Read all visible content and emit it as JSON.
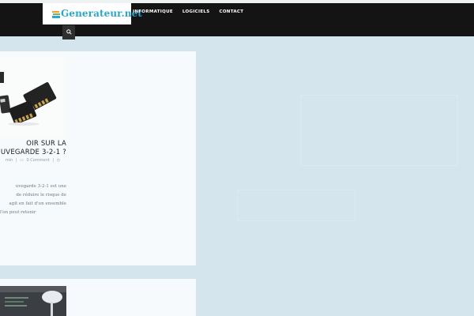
{
  "header": {
    "logo_text": "Generateur.net",
    "nav": [
      "INFORMATIQUE",
      "LOGICIELS",
      "CONTACT"
    ]
  },
  "search": {
    "icon": "search-icon"
  },
  "posts": [
    {
      "title_line1": "OIR SUR LA",
      "title_line2": "UVEGARDE 3-2-1 ?",
      "meta_author": "min",
      "meta_comments": "0 Comment",
      "meta_sep": "|",
      "excerpt": [
        "uvegarde 3-2-1 est une",
        "de réduire le risque de",
        "agit en fait d'un ensemble",
        "l'on peut retenir"
      ]
    }
  ],
  "colors": {
    "nav_bg": "#141414",
    "page_bg": "#d4e5ed",
    "card_bg": "#f7fafc",
    "logo_color": "#2ba8c9"
  }
}
